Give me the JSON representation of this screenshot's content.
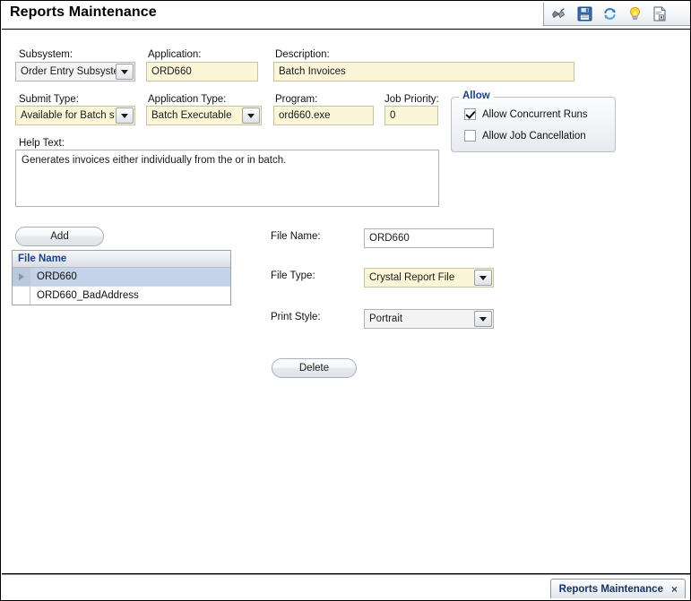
{
  "window": {
    "title": "Reports Maintenance"
  },
  "toolbar": {
    "buttons": [
      {
        "name": "find-binoculars-icon",
        "label": "Find"
      },
      {
        "name": "save-floppy-icon",
        "label": "Save"
      },
      {
        "name": "refresh-icon",
        "label": "Refresh"
      },
      {
        "name": "lightbulb-icon",
        "label": "Hint"
      },
      {
        "name": "report-page-icon",
        "label": "Report"
      }
    ]
  },
  "form": {
    "subsystem": {
      "label": "Subsystem:",
      "value": "Order Entry Subsystem"
    },
    "application": {
      "label": "Application:",
      "value": "ORD660"
    },
    "description": {
      "label": "Description:",
      "value": "Batch Invoices"
    },
    "submit_type": {
      "label": "Submit Type:",
      "value": "Available for Batch s"
    },
    "application_type": {
      "label": "Application Type:",
      "value": "Batch Executable"
    },
    "program": {
      "label": "Program:",
      "value": "ord660.exe"
    },
    "job_priority": {
      "label": "Job Priority:",
      "value": "0"
    },
    "help_text": {
      "label": "Help Text:",
      "value": "Generates invoices either individually from the or in batch."
    }
  },
  "allow_group": {
    "legend": "Allow",
    "options": [
      {
        "label": "Allow Concurrent Runs",
        "checked": true
      },
      {
        "label": "Allow Job Cancellation",
        "checked": false
      }
    ]
  },
  "file_section": {
    "add_button": "Add",
    "delete_button": "Delete",
    "grid": {
      "columns": [
        "File Name"
      ],
      "rows": [
        {
          "file_name": "ORD660",
          "selected": true
        },
        {
          "file_name": "ORD660_BadAddress",
          "selected": false
        }
      ]
    },
    "file_name": {
      "label": "File Name:",
      "value": "ORD660"
    },
    "file_type": {
      "label": "File Type:",
      "value": "Crystal Report File"
    },
    "print_style": {
      "label": "Print Style:",
      "value": "Portrait"
    }
  },
  "tabstrip": {
    "tabs": [
      {
        "label": "Reports Maintenance",
        "close": "×"
      }
    ]
  },
  "colors": {
    "required_field_yellow": "#fbf6d8",
    "header_blue": "#16418c",
    "grid_selection": "#c4d3e7"
  }
}
